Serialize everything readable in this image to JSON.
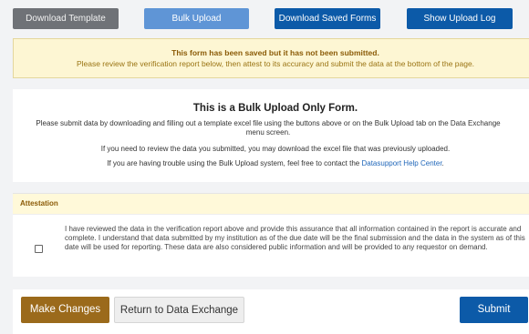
{
  "toolbar": {
    "download_template": "Download Template",
    "bulk_upload": "Bulk Upload",
    "download_saved_forms": "Download Saved Forms",
    "show_upload_log": "Show Upload Log"
  },
  "warning": {
    "title": "This form has been saved but it has not been submitted.",
    "message": "Please review the verification report below, then attest to its accuracy and submit the data at the bottom of the page."
  },
  "info": {
    "title": "This is a Bulk Upload Only Form.",
    "line1": "Please submit data by downloading and filling out a template excel file using the buttons above or on the Bulk Upload tab on the Data Exchange menu screen.",
    "line2": "If you need to review the data you submitted, you may download the excel file that was previously uploaded.",
    "line3_prefix": "If you are having trouble using the Bulk Upload system, feel free to contact the ",
    "line3_link": "Datasupport Help Center",
    "line3_suffix": "."
  },
  "attestation": {
    "heading": "Attestation",
    "checked": false,
    "text": "I have reviewed the data in the verification report above and provide this assurance that all information contained in the report is accurate and complete. I understand that data submitted by my institution as of the due date will be the final submission and the data in the system as of this date will be used for reporting. These data are also considered public information and will be provided to any requestor on demand."
  },
  "actions": {
    "make_changes": "Make Changes",
    "return": "Return to Data Exchange",
    "submit": "Submit"
  },
  "colors": {
    "primary_blue": "#0c5aa8",
    "light_blue": "#5f95d6",
    "grey": "#6f7277",
    "brown": "#9b6a1b",
    "warning_bg": "#fdf6d3",
    "link": "#1f66b9"
  }
}
